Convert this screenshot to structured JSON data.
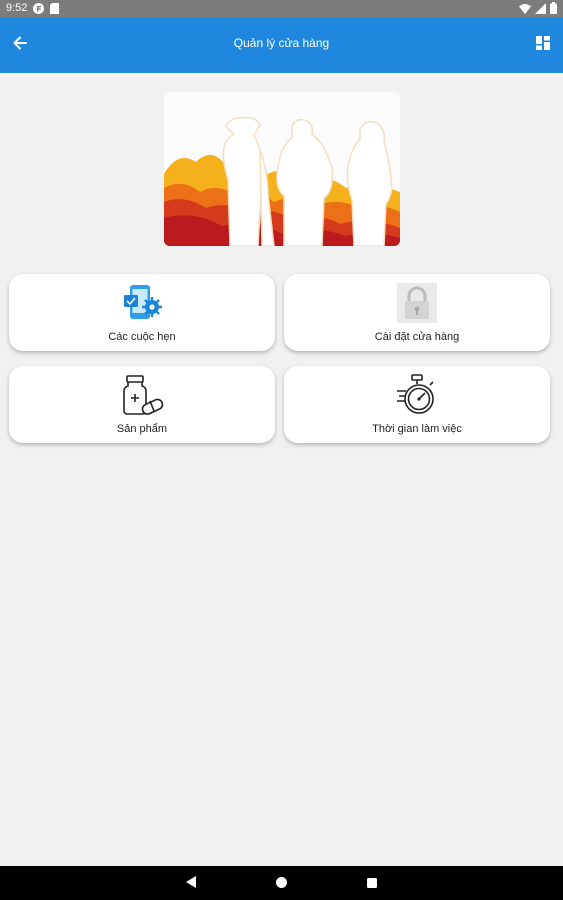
{
  "status_bar": {
    "time": "9:52"
  },
  "app_bar": {
    "title": "Quản lý cửa hàng"
  },
  "menu": [
    {
      "label": "Các cuộc hẹn",
      "icon": "appointment-phone-icon"
    },
    {
      "label": "Cài đặt cửa hàng",
      "icon": "padlock-icon"
    },
    {
      "label": "Sản phẩm",
      "icon": "medicine-bottle-icon"
    },
    {
      "label": "Thời gian làm việc",
      "icon": "stopwatch-icon"
    }
  ],
  "colors": {
    "app_bar": "#1f87dd",
    "status_bar": "#7c7c7c",
    "background": "#f1f1f1",
    "nav_bar": "#000000"
  }
}
